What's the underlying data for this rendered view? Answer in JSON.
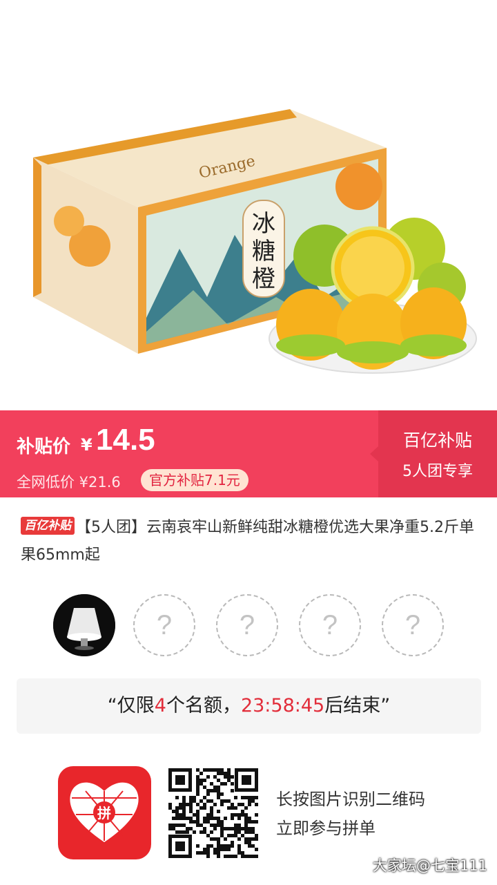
{
  "product_image": {
    "box_text_orange": "Orange",
    "box_label": [
      "冰",
      "糖",
      "橙"
    ]
  },
  "price_bar": {
    "subsidy_label": "补贴价",
    "currency_symbol": "¥",
    "price": "14.5",
    "lowest_price_text": "全网低价 ¥21.6",
    "subsidy_pill": "官方补贴7.1元",
    "badge_title": "百亿补贴",
    "badge_sub": "5人团专享"
  },
  "title": {
    "tag": "百亿补贴",
    "text": "【5人团】云南哀牢山新鲜纯甜冰糖橙优选大果净重5.2斤单果65mm起"
  },
  "avatars": {
    "placeholder": "?",
    "slots": [
      "filled",
      "empty",
      "empty",
      "empty",
      "empty"
    ]
  },
  "countdown": {
    "prefix": "“仅限",
    "count": "4",
    "middle": "个名额，",
    "time": "23:58:45",
    "suffix": "后结束”"
  },
  "bottom": {
    "logo_text": "拼",
    "hint_line1": "长按图片识别二维码",
    "hint_line2": "立即参与拼单"
  },
  "watermark": "大家坛@七宝111",
  "colors": {
    "price_bar_bg": "#f2405c",
    "badge_bg": "#e3354f",
    "highlight": "#e22d3a",
    "logo_bg": "#e8262b"
  }
}
